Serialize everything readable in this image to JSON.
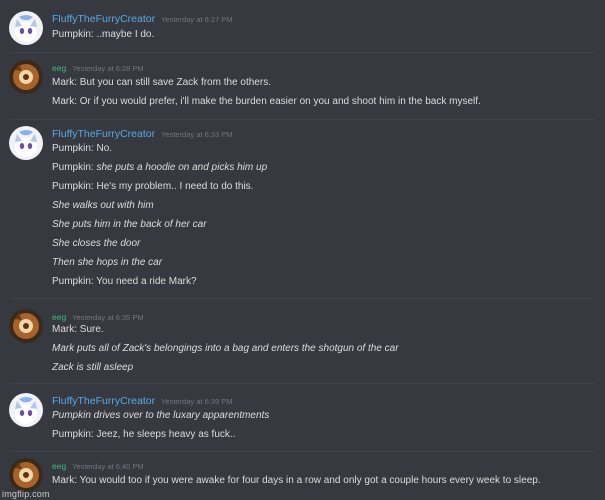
{
  "users": {
    "fluffy": "FluffyTheFurryCreator",
    "eeg": "eeg"
  },
  "groups": [
    {
      "timestamp": "Yesterday at 6:27 PM",
      "messages": [
        {
          "speaker": "Pumpkin:",
          "text": " ..maybe I do.",
          "italic": false
        }
      ]
    },
    {
      "timestamp": "Yesterday at 6:28 PM",
      "messages": [
        {
          "speaker": "Mark:",
          "text": " But you can still save Zack from the others.",
          "italic": false
        },
        {
          "speaker": "Mark:",
          "text": " Or if you would prefer, i'll make the burden easier on you and shoot him in the back myself.",
          "italic": false
        }
      ]
    },
    {
      "timestamp": "Yesterday at 6:33 PM",
      "messages": [
        {
          "speaker": "Pumpkin:",
          "text": " No.",
          "italic": false
        },
        {
          "speaker": "Pumpkin:",
          "text": " she puts a hoodie on and picks him up",
          "italic": true
        },
        {
          "speaker": "Pumpkin:",
          "text": " He's my problem.. I need to do this.",
          "italic": false
        },
        {
          "speaker": "",
          "text": "She walks out with him",
          "italic": true
        },
        {
          "speaker": "",
          "text": "She puts him in the back of her car",
          "italic": true
        },
        {
          "speaker": "",
          "text": "She closes the door",
          "italic": true
        },
        {
          "speaker": "",
          "text": "Then she hops in the car",
          "italic": true
        },
        {
          "speaker": "Pumpkin:",
          "text": " You need a ride Mark?",
          "italic": false
        }
      ]
    },
    {
      "timestamp": "Yesterday at 6:35 PM",
      "messages": [
        {
          "speaker": "Mark:",
          "text": " Sure.",
          "italic": false
        },
        {
          "speaker": "",
          "text": "Mark puts all of Zack's belongings into a bag and enters the shotgun of the car",
          "italic": true
        },
        {
          "speaker": "",
          "text": "Zack is still asleep",
          "italic": true
        }
      ]
    },
    {
      "timestamp": "Yesterday at 6:39 PM",
      "messages": [
        {
          "speaker": "",
          "text": "Pumpkin drives over to the luxary apparentments",
          "italic": true
        },
        {
          "speaker": "Pumpkin:",
          "text": " Jeez, he sleeps heavy as fuck..",
          "italic": false
        }
      ]
    },
    {
      "timestamp": "Yesterday at 6:40 PM",
      "messages": [
        {
          "speaker": "Mark:",
          "text": " You would too if you were awake for four days in a row and only got a couple hours every week to sleep.",
          "italic": false
        }
      ]
    }
  ],
  "watermark": "imgflip.com",
  "colors": {
    "background": "#36393f",
    "fluffy_name": "#5aa9e6",
    "eeg_name": "#43b581",
    "timestamp": "#72767d",
    "message_text": "#dcddde"
  }
}
